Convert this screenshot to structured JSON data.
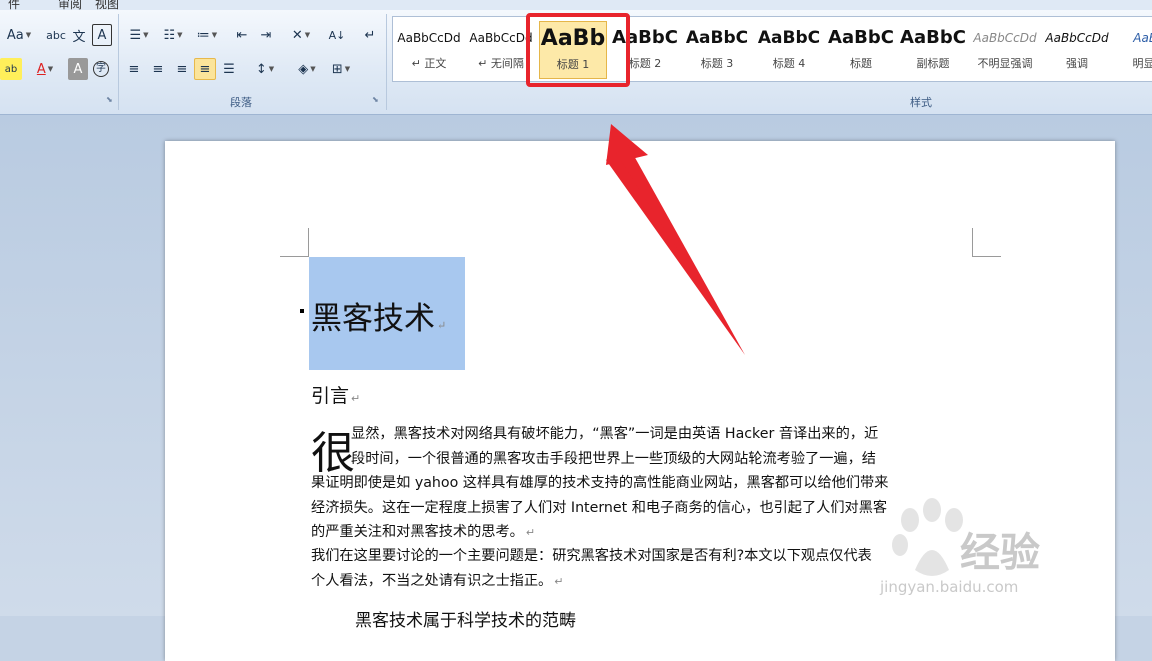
{
  "tabs": [
    "件",
    "审阅",
    "视图"
  ],
  "ribbon": {
    "font_group": {
      "buttons": [
        "Aa",
        "A",
        "A",
        "文",
        "A",
        "A"
      ]
    },
    "paragraph_group": {
      "label": "段落"
    },
    "styles_group": {
      "label": "样式",
      "items": [
        {
          "preview": "AaBbCcDd",
          "name": "↵ 正文"
        },
        {
          "preview": "AaBbCcDd",
          "name": "↵ 无间隔"
        },
        {
          "preview": "AaBb",
          "name": "标题 1"
        },
        {
          "preview": "AaBbC",
          "name": "标题 2"
        },
        {
          "preview": "AaBbC",
          "name": "标题 3"
        },
        {
          "preview": "AaBbC",
          "name": "标题 4"
        },
        {
          "preview": "AaBbC",
          "name": "标题"
        },
        {
          "preview": "AaBbC",
          "name": "副标题"
        },
        {
          "preview": "AaBbCcDd",
          "name": "不明显强调"
        },
        {
          "preview": "AaBbCcDd",
          "name": "强调"
        },
        {
          "preview": "AaBb",
          "name": "明显强"
        }
      ]
    }
  },
  "document": {
    "title": "黑客技术",
    "heading": "引言",
    "dropcap": "很",
    "para1_lines": [
      "显然，黑客技术对网络具有破坏能力，“黑客”一词是由英语 Hacker 音译出来的，近",
      "段时间，一个很普通的黑客攻击手段把世界上一些顶级的大网站轮流考验了一遍，结",
      "果证明即使是如 yahoo 这样具有雄厚的技术支持的高性能商业网站，黑客都可以给他们带来",
      "经济损失。这在一定程度上损害了人们对 Internet 和电子商务的信心，也引起了人们对黑客",
      "的严重关注和对黑客技术的思考。"
    ],
    "para2_lines": [
      "我们在这里要讨论的一个主要问题是：研究黑客技术对国家是否有利?本文以下观点仅代表",
      "个人看法，不当之处请有识之士指正。"
    ],
    "next_heading": "黑客技术属于科学技术的范畴"
  },
  "watermark": {
    "text": "经验",
    "url": "jingyan.baidu.com"
  },
  "colors": {
    "callout": "#e8242c",
    "selection": "#a8c8ef",
    "active_style": "#fde9a8"
  }
}
